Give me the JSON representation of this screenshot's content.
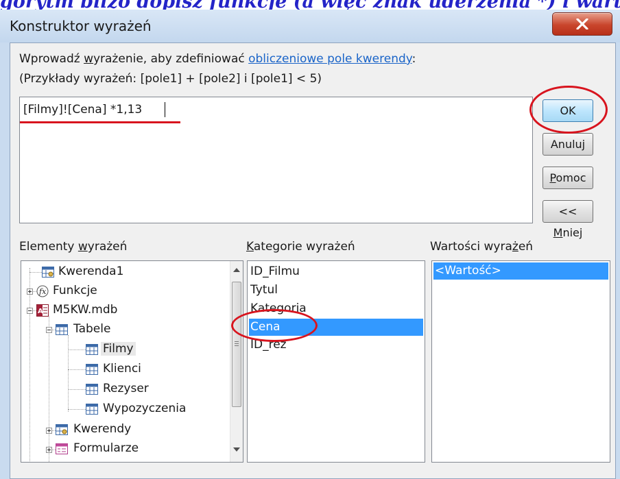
{
  "caption": "gorytm bliżo dopisz funkcje (a więc znak uderzenia *) i wartość (czyli",
  "window": {
    "title": "Konstruktor wyrażeń"
  },
  "instruction": {
    "line1_pre": "Wprowadź ",
    "line1_ul": "w",
    "line1_mid": "yrażenie, aby zdefiniować ",
    "line1_link": "obliczeniowe pole kwerendy",
    "line1_post": ":",
    "line2": "(Przykłady wyrażeń: [pole1] + [pole2] i [pole1] < 5)"
  },
  "expression": {
    "value": "[Filmy]![Cena] *1,13"
  },
  "buttons": {
    "ok": "OK",
    "cancel": "Anuluj",
    "help_ul": "P",
    "help_rest": "omoc",
    "less_pre": "<< ",
    "less_ul": "M",
    "less_rest": "niej"
  },
  "panels": {
    "elements": {
      "pre": "Elementy ",
      "ul": "w",
      "post": "yrażeń"
    },
    "categories": {
      "ul": "K",
      "post": "ategorie wyrażeń"
    },
    "values": {
      "pre": "Wartości wyra",
      "ul": "ż",
      "post": "eń"
    }
  },
  "tree": {
    "kwerenda1": "Kwerenda1",
    "funkcje": "Funkcje",
    "db": "M5KW.mdb",
    "tabele": "Tabele",
    "filmy": "Filmy",
    "klienci": "Klienci",
    "rezyser": "Rezyser",
    "wypozyczenia": "Wypozyczenia",
    "kwerendy": "Kwerendy",
    "formularze": "Formularze"
  },
  "categories_list": [
    "ID_Filmu",
    "Tytul",
    "Kategoria",
    "Cena",
    "ID_rez"
  ],
  "selected_category": "Cena",
  "values_list": [
    "<Wartość>"
  ],
  "colors": {
    "highlight": "#3399ff",
    "annotation": "#d8141e",
    "link": "#1a64c8"
  }
}
